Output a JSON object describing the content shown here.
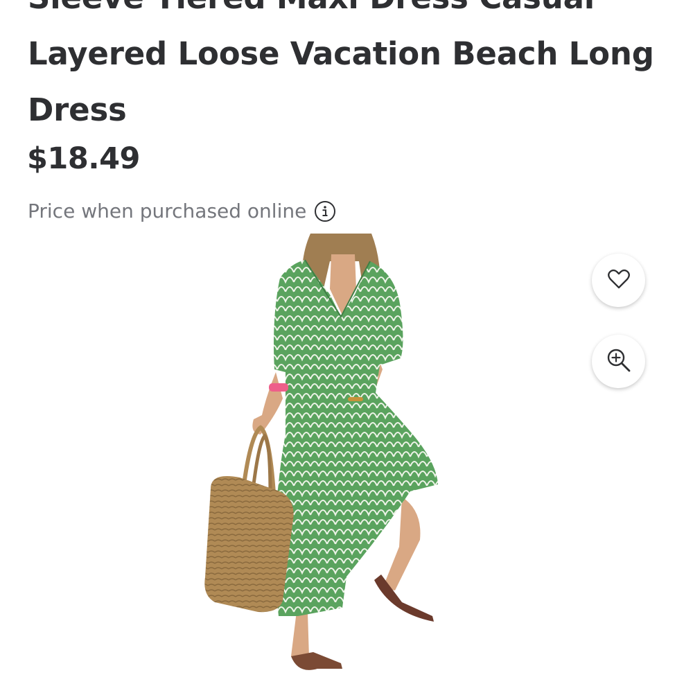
{
  "product": {
    "title_lines": [
      "Sleeve Tiered Maxi Dress Casual",
      "Layered Loose Vacation Beach Long",
      "Dress"
    ],
    "price": "$18.49",
    "price_note": "Price when purchased online",
    "image_alt": "Green printed tiered maxi dress with straw tote bag"
  },
  "actions": {
    "favorite_icon": "heart-icon",
    "zoom_icon": "zoom-in-icon",
    "info_icon": "info-icon"
  },
  "colors": {
    "text": "#2e2f32",
    "muted": "#74767c",
    "dress_green": "#5aa35e",
    "bag": "#b08a55"
  }
}
